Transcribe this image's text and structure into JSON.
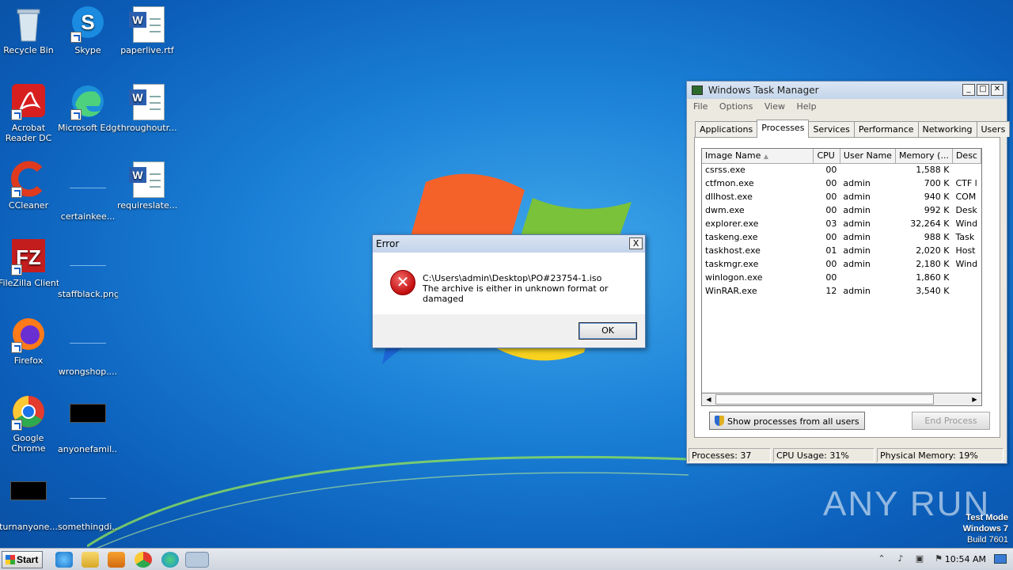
{
  "desktop": {
    "icons": [
      {
        "label": "Recycle Bin"
      },
      {
        "label": "Skype"
      },
      {
        "label": "paperlive.rtf"
      },
      {
        "label": "Acrobat Reader DC"
      },
      {
        "label": "Microsoft Edge"
      },
      {
        "label": "throughoutr..."
      },
      {
        "label": "CCleaner"
      },
      {
        "label": "certainkee..."
      },
      {
        "label": "requireslate..."
      },
      {
        "label": "FileZilla Client"
      },
      {
        "label": "staffblack.png"
      },
      {
        "label": "Firefox"
      },
      {
        "label": "wrongshop...."
      },
      {
        "label": "Google Chrome"
      },
      {
        "label": "anyonefamil..."
      },
      {
        "label": "turnanyone..."
      },
      {
        "label": "somethingdi..."
      }
    ]
  },
  "error_dialog": {
    "title": "Error",
    "close": "X",
    "path": "C:\\Users\\admin\\Desktop\\PO#23754-1.iso",
    "message": "The archive is either in unknown format or damaged",
    "ok_label": "OK"
  },
  "task_manager": {
    "title": "Windows Task Manager",
    "menu": [
      "File",
      "Options",
      "View",
      "Help"
    ],
    "tabs": [
      "Applications",
      "Processes",
      "Services",
      "Performance",
      "Networking",
      "Users"
    ],
    "active_tab": "Processes",
    "columns": [
      "Image Name",
      "CPU",
      "User Name",
      "Memory (...",
      "Desc"
    ],
    "rows": [
      {
        "name": "csrss.exe",
        "cpu": "00",
        "user": "",
        "mem": "1,588 K",
        "desc": ""
      },
      {
        "name": "ctfmon.exe",
        "cpu": "00",
        "user": "admin",
        "mem": "700 K",
        "desc": "CTF l"
      },
      {
        "name": "dllhost.exe",
        "cpu": "00",
        "user": "admin",
        "mem": "940 K",
        "desc": "COM"
      },
      {
        "name": "dwm.exe",
        "cpu": "00",
        "user": "admin",
        "mem": "992 K",
        "desc": "Desk"
      },
      {
        "name": "explorer.exe",
        "cpu": "03",
        "user": "admin",
        "mem": "32,264 K",
        "desc": "Wind"
      },
      {
        "name": "taskeng.exe",
        "cpu": "00",
        "user": "admin",
        "mem": "988 K",
        "desc": "Task"
      },
      {
        "name": "taskhost.exe",
        "cpu": "01",
        "user": "admin",
        "mem": "2,020 K",
        "desc": "Host"
      },
      {
        "name": "taskmgr.exe",
        "cpu": "00",
        "user": "admin",
        "mem": "2,180 K",
        "desc": "Wind"
      },
      {
        "name": "winlogon.exe",
        "cpu": "00",
        "user": "",
        "mem": "1,860 K",
        "desc": ""
      },
      {
        "name": "WinRAR.exe",
        "cpu": "12",
        "user": "admin",
        "mem": "3,540 K",
        "desc": ""
      }
    ],
    "show_all_label": "Show processes from all users",
    "end_process_label": "End Process",
    "status": {
      "processes": "Processes: 37",
      "cpu": "CPU Usage: 31%",
      "memory": "Physical Memory: 19%"
    }
  },
  "watermark": {
    "text": "ANY RUN"
  },
  "test_mode": {
    "line1": "Test Mode",
    "line2": "Windows 7",
    "line3": "Build 7601"
  },
  "taskbar": {
    "start_label": "Start",
    "time": "10:54 AM"
  }
}
